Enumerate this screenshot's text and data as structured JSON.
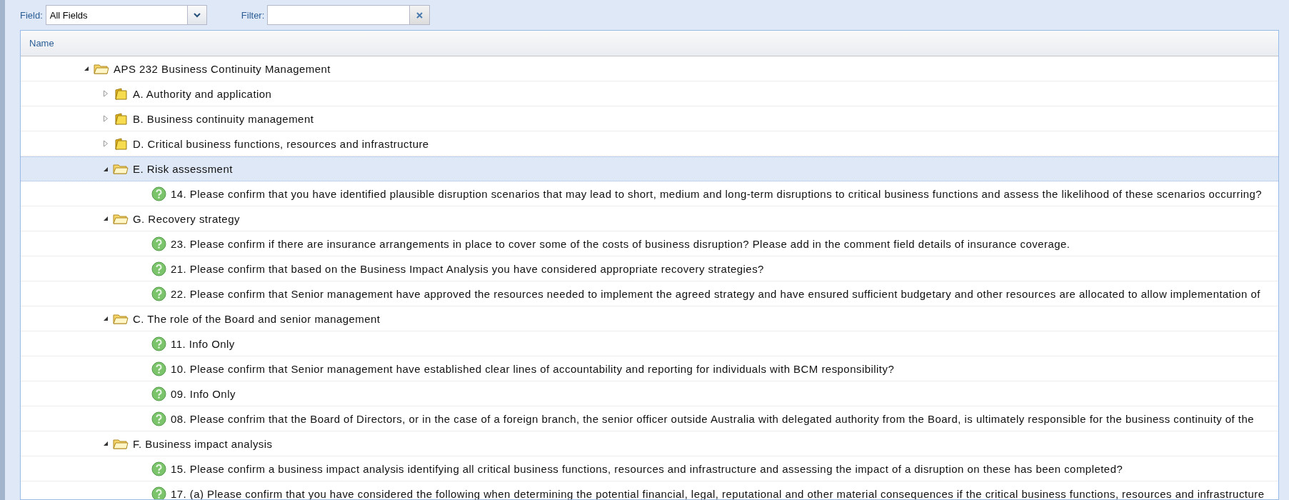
{
  "toolbar": {
    "field_label": "Field:",
    "field_value": "All Fields",
    "filter_label": "Filter:"
  },
  "grid": {
    "columns": [
      "Name"
    ],
    "tree": [
      {
        "kind": "folder",
        "label": "APS 232 Business Continuity Management",
        "expanded": true,
        "selected": false,
        "children": [
          {
            "kind": "folder",
            "label": "A. Authority and application",
            "expanded": false,
            "selected": false
          },
          {
            "kind": "folder",
            "label": "B. Business continuity management",
            "expanded": false,
            "selected": false
          },
          {
            "kind": "folder",
            "label": "D. Critical business functions, resources and infrastructure",
            "expanded": false,
            "selected": false
          },
          {
            "kind": "folder",
            "label": "E. Risk assessment",
            "expanded": true,
            "selected": true,
            "children": [
              {
                "kind": "question",
                "label": "14. Please confirm that you have identified plausible disruption scenarios that may lead to short, medium and long-term disruptions to critical business functions and assess the likelihood of these scenarios occurring?",
                "selected": false
              }
            ]
          },
          {
            "kind": "folder",
            "label": "G. Recovery strategy",
            "expanded": true,
            "selected": false,
            "children": [
              {
                "kind": "question",
                "label": "23. Please confirm if there are insurance arrangements in place to cover some of the costs of business disruption? Please add in the comment field details of insurance coverage.",
                "selected": false
              },
              {
                "kind": "question",
                "label": "21. Please confirm that based on the Business Impact Analysis you have considered appropriate recovery strategies?",
                "selected": false
              },
              {
                "kind": "question",
                "label": "22. Please confirm that Senior management have approved the resources needed to implement the agreed strategy and have ensured sufficient budgetary and other resources are allocated to allow implementation of",
                "selected": false
              }
            ]
          },
          {
            "kind": "folder",
            "label": "C. The role of the Board and senior management",
            "expanded": true,
            "selected": false,
            "children": [
              {
                "kind": "question",
                "label": "11. Info Only",
                "selected": false
              },
              {
                "kind": "question",
                "label": "10. Please confirm that Senior management have established clear lines of accountability and reporting for individuals with BCM responsibility?",
                "selected": false
              },
              {
                "kind": "question",
                "label": "09. Info Only",
                "selected": false
              },
              {
                "kind": "question",
                "label": "08. Please confrim that the Board of Directors, or in the case of a foreign branch, the senior officer outside Australia with delegated authority from the Board, is ultimately responsible for the business continuity of the",
                "selected": false
              }
            ]
          },
          {
            "kind": "folder",
            "label": "F. Business impact analysis",
            "expanded": true,
            "selected": false,
            "children": [
              {
                "kind": "question",
                "label": "15. Please confirm a business impact analysis identifying all critical business functions, resources and infrastructure and assessing the impact of a disruption on these has been completed?",
                "selected": false
              },
              {
                "kind": "question",
                "label": "17. (a) Please confirm that you have considered the following when determining the potential financial, legal, reputational and other material consequences if the critical business functions, resources and infrastructure",
                "selected": false
              }
            ]
          }
        ]
      }
    ]
  }
}
